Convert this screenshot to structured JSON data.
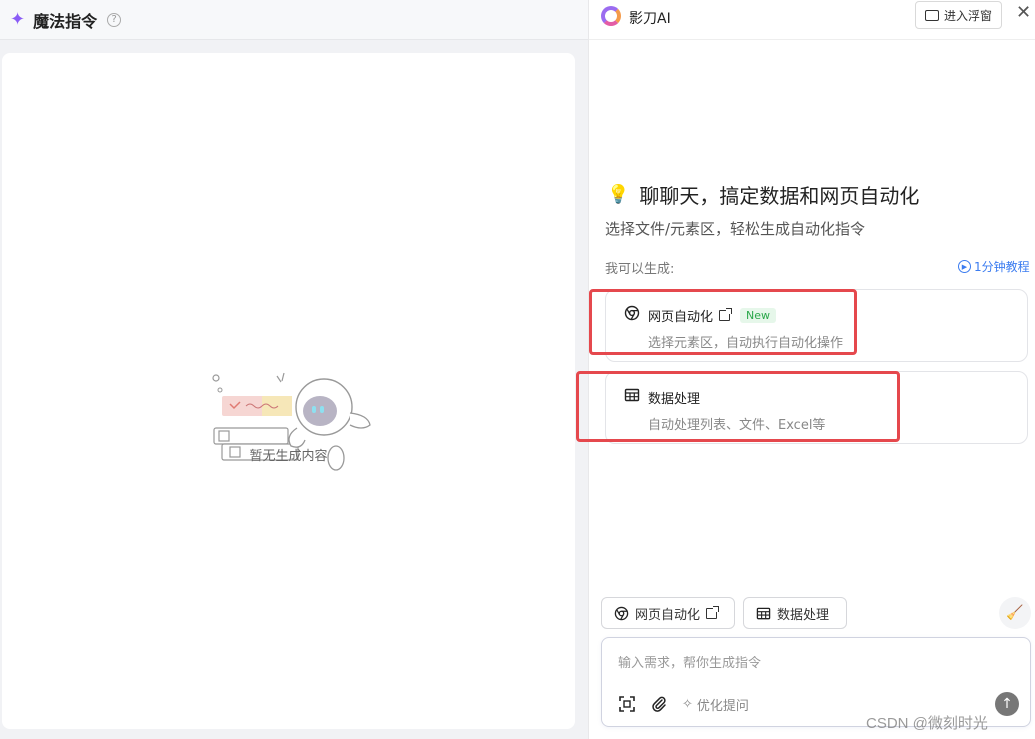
{
  "left": {
    "title": "魔法指令",
    "help_icon": "question-circle-icon",
    "empty_text": "暂无生成内容"
  },
  "right": {
    "app_name": "影刀AI",
    "float_button": "进入浮窗",
    "close": "✕",
    "hero_title": "聊聊天，搞定数据和网页自动化",
    "hero_subtitle": "选择文件/元素区，轻松生成自动化指令",
    "can_generate": "我可以生成:",
    "tutorial": "1分钟教程",
    "cards": [
      {
        "title": "网页自动化",
        "badge": "New",
        "desc": "选择元素区，自动执行自动化操作",
        "icon": "chrome-icon"
      },
      {
        "title": "数据处理",
        "desc": "自动处理列表、文件、Excel等",
        "icon": "table-icon"
      }
    ],
    "chips": [
      {
        "label": "网页自动化",
        "icon": "chrome-icon"
      },
      {
        "label": "数据处理",
        "icon": "table-icon"
      }
    ],
    "input_placeholder": "输入需求，帮你生成指令",
    "optimize": "优化提问",
    "send_icon": "arrow-up-icon"
  },
  "colors": {
    "accent_purple": "#8a5cf6",
    "link_blue": "#3b7cf0",
    "highlight_red": "#e5484d",
    "new_green": "#2aa84a"
  },
  "watermark": "CSDN @微刻时光"
}
